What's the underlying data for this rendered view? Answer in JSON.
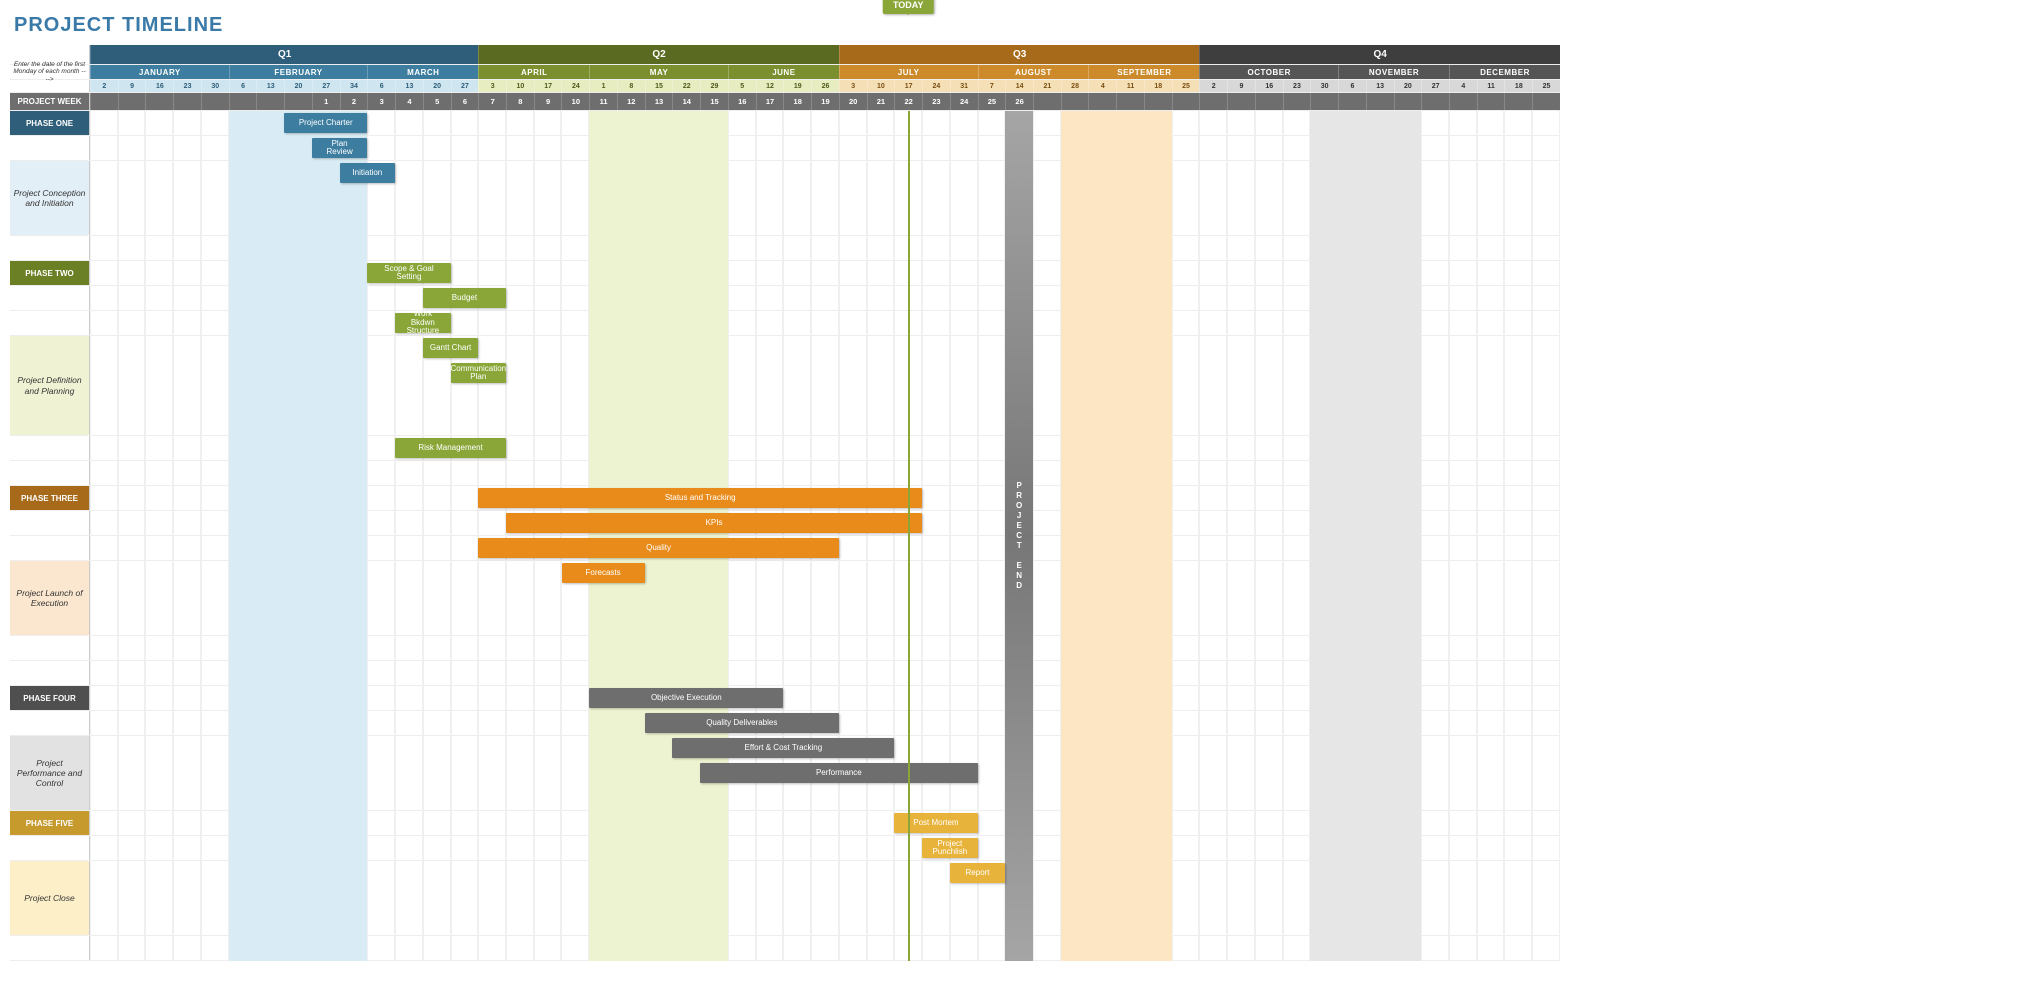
{
  "title": "PROJECT TIMELINE",
  "today_label": "TODAY",
  "project_end_label": "PROJECT END",
  "side_note": "Enter the date of the first Monday of each month ---->",
  "week_header": "PROJECT WEEK",
  "quarters": [
    {
      "label": "Q1",
      "class": "q1",
      "months": [
        {
          "label": "JANUARY",
          "days": [
            2,
            9,
            16,
            23,
            30
          ]
        },
        {
          "label": "FEBRUARY",
          "days": [
            6,
            13,
            20,
            27,
            34
          ]
        },
        {
          "label": "MARCH",
          "days": [
            6,
            13,
            20,
            27
          ]
        }
      ]
    },
    {
      "label": "Q2",
      "class": "q2",
      "months": [
        {
          "label": "APRIL",
          "days": [
            3,
            10,
            17,
            24
          ]
        },
        {
          "label": "MAY",
          "days": [
            1,
            8,
            15,
            22,
            29
          ]
        },
        {
          "label": "JUNE",
          "days": [
            5,
            12,
            19,
            26
          ]
        }
      ]
    },
    {
      "label": "Q3",
      "class": "q3",
      "months": [
        {
          "label": "JULY",
          "days": [
            3,
            10,
            17,
            24,
            31
          ]
        },
        {
          "label": "AUGUST",
          "days": [
            7,
            14,
            21,
            28
          ]
        },
        {
          "label": "SEPTEMBER",
          "days": [
            4,
            11,
            18,
            25
          ]
        }
      ]
    },
    {
      "label": "Q4",
      "class": "q4",
      "months": [
        {
          "label": "OCTOBER",
          "days": [
            2,
            9,
            16,
            23,
            30
          ]
        },
        {
          "label": "NOVEMBER",
          "days": [
            6,
            13,
            20,
            27
          ]
        },
        {
          "label": "DECEMBER",
          "days": [
            4,
            11,
            18,
            25
          ]
        }
      ]
    }
  ],
  "weeks": [
    "",
    "",
    "",
    "",
    "",
    "",
    "",
    "",
    "1",
    "2",
    "3",
    "4",
    "5",
    "6",
    "7",
    "8",
    "9",
    "10",
    "11",
    "12",
    "13",
    "14",
    "15",
    "16",
    "17",
    "18",
    "19",
    "20",
    "21",
    "22",
    "23",
    "24",
    "25",
    "26",
    "",
    "",
    "",
    "",
    "",
    "",
    "",
    "",
    "",
    "",
    "",
    "",
    "",
    "",
    "",
    "",
    "",
    "",
    ""
  ],
  "phases": {
    "one": {
      "label": "PHASE ONE",
      "section": "Project Conception and Initiation"
    },
    "two": {
      "label": "PHASE TWO",
      "section": "Project Definition and Planning"
    },
    "three": {
      "label": "PHASE THREE",
      "section": "Project Launch of Execution"
    },
    "four": {
      "label": "PHASE FOUR",
      "section": "Project Performance and Control"
    },
    "five": {
      "label": "PHASE FIVE",
      "section": "Project Close"
    }
  },
  "chart_data": {
    "type": "gantt",
    "unit": "project-week-column (53 total)",
    "today_col": 30,
    "project_end_col": 34,
    "shade_cols": {
      "feb": [
        6,
        10
      ],
      "may": [
        19,
        23
      ],
      "aug": [
        36,
        39
      ],
      "nov": [
        45,
        48
      ]
    },
    "tasks": [
      {
        "phase": "one",
        "label": "Project Charter",
        "row": 0,
        "start": 8,
        "span": 3,
        "color": "c1"
      },
      {
        "phase": "one",
        "label": "Plan Review",
        "row": 1,
        "start": 9,
        "span": 2,
        "color": "c1"
      },
      {
        "phase": "one",
        "label": "Initiation",
        "row": 2,
        "start": 10,
        "span": 2,
        "color": "c1"
      },
      {
        "phase": "two",
        "label": "Scope & Goal Setting",
        "row": 4,
        "start": 11,
        "span": 3,
        "color": "c2"
      },
      {
        "phase": "two",
        "label": "Budget",
        "row": 5,
        "start": 13,
        "span": 3,
        "color": "c2"
      },
      {
        "phase": "two",
        "label": "Work Bkdwn Structure",
        "row": 6,
        "start": 12,
        "span": 2,
        "color": "c2"
      },
      {
        "phase": "two",
        "label": "Gantt Chart",
        "row": 7,
        "start": 13,
        "span": 2,
        "color": "c2"
      },
      {
        "phase": "two",
        "label": "Communication Plan",
        "row": 8,
        "start": 14,
        "span": 2,
        "color": "c2"
      },
      {
        "phase": "two",
        "label": "Risk Management",
        "row": 9,
        "start": 12,
        "span": 4,
        "color": "c2"
      },
      {
        "phase": "three",
        "label": "Status  and Tracking",
        "row": 10,
        "start": 15,
        "span": 16,
        "color": "c3"
      },
      {
        "phase": "three",
        "label": "KPIs",
        "row": 11,
        "start": 16,
        "span": 15,
        "color": "c3"
      },
      {
        "phase": "three",
        "label": "Quality",
        "row": 12,
        "start": 15,
        "span": 13,
        "color": "c3"
      },
      {
        "phase": "three",
        "label": "Forecasts",
        "row": 13,
        "start": 18,
        "span": 3,
        "color": "c3"
      },
      {
        "phase": "four",
        "label": "Objective Execution",
        "row": 15,
        "start": 19,
        "span": 7,
        "color": "c4"
      },
      {
        "phase": "four",
        "label": "Quality Deliverables",
        "row": 16,
        "start": 21,
        "span": 7,
        "color": "c4"
      },
      {
        "phase": "four",
        "label": "Effort & Cost Tracking",
        "row": 17,
        "start": 22,
        "span": 8,
        "color": "c4"
      },
      {
        "phase": "four",
        "label": "Performance",
        "row": 18,
        "start": 23,
        "span": 10,
        "color": "c4"
      },
      {
        "phase": "five",
        "label": "Post Mortem",
        "row": 19,
        "start": 30,
        "span": 3,
        "color": "c5"
      },
      {
        "phase": "five",
        "label": "Project Punchlish",
        "row": 20,
        "start": 31,
        "span": 2,
        "color": "c5"
      },
      {
        "phase": "five",
        "label": "Report",
        "row": 21,
        "start": 32,
        "span": 2,
        "color": "c5"
      }
    ],
    "body_rows": [
      {
        "type": "phase",
        "key": "one",
        "ph": "ph1"
      },
      {
        "type": "task",
        "idx": 1
      },
      {
        "type": "sect",
        "key": "one",
        "ph": "ph1",
        "idx": 2,
        "big": "bigrow"
      },
      {
        "type": "blank"
      },
      {
        "type": "phase",
        "key": "two",
        "ph": "ph2",
        "idx": 3
      },
      {
        "type": "task",
        "idx": 4
      },
      {
        "type": "task",
        "idx": 5
      },
      {
        "type": "sect",
        "key": "two",
        "ph": "ph2",
        "idx": 6,
        "big": "bigrow4"
      },
      {
        "type": "task",
        "idx": 8
      },
      {
        "type": "blank"
      },
      {
        "type": "phase",
        "key": "three",
        "ph": "ph3",
        "idx": 9
      },
      {
        "type": "task",
        "idx": 10
      },
      {
        "type": "task",
        "idx": 11
      },
      {
        "type": "sect",
        "key": "three",
        "ph": "ph3",
        "idx": 12,
        "big": "bigrow"
      },
      {
        "type": "blank"
      },
      {
        "type": "blank"
      },
      {
        "type": "phase",
        "key": "four",
        "ph": "ph4",
        "idx": 14
      },
      {
        "type": "task",
        "idx": 15
      },
      {
        "type": "sect",
        "key": "four",
        "ph": "ph4",
        "idx": 16,
        "big": "bigrow"
      },
      {
        "type": "phase",
        "key": "five",
        "ph": "ph5",
        "idx": 18
      },
      {
        "type": "task",
        "idx": 19
      },
      {
        "type": "sect",
        "key": "five",
        "ph": "ph5",
        "idx": 20,
        "big": "bigrow"
      },
      {
        "type": "blank"
      }
    ]
  }
}
